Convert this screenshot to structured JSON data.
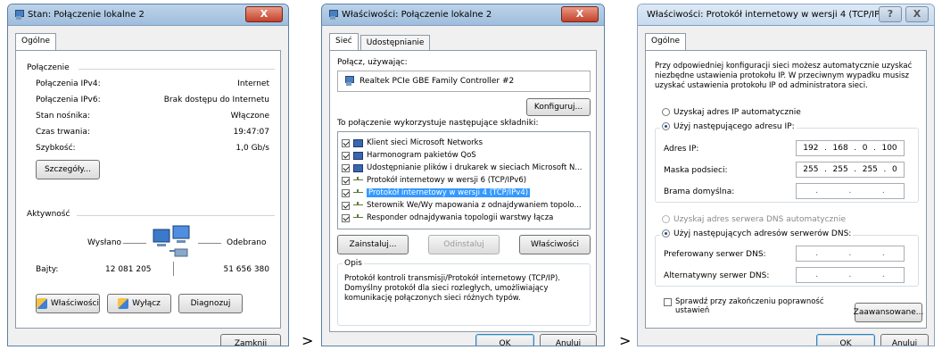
{
  "win1": {
    "title": "Stan: Połączenie lokalne 2",
    "close": "X",
    "tab": "Ogólne",
    "connection_header": "Połączenie",
    "rows": [
      {
        "label": "Połączenia IPv4:",
        "value": "Internet"
      },
      {
        "label": "Połączenia IPv6:",
        "value": "Brak dostępu do Internetu"
      },
      {
        "label": "Stan nośnika:",
        "value": "Włączone"
      },
      {
        "label": "Czas trwania:",
        "value": "19:47:07"
      },
      {
        "label": "Szybkość:",
        "value": "1,0 Gb/s"
      }
    ],
    "details_btn": "Szczegóły...",
    "activity_header": "Aktywność",
    "sent": "Wysłano",
    "received": "Odebrano",
    "bytes_label": "Bajty:",
    "bytes_sent": "12 081 205",
    "bytes_recv": "51 656 380",
    "props_btn": "Właściwości",
    "disable_btn": "Wyłącz",
    "diag_btn": "Diagnozuj",
    "close_btn": "Zamknij"
  },
  "win2": {
    "title": "Właściwości: Połączenie lokalne 2",
    "close": "X",
    "tab_net": "Sieć",
    "tab_share": "Udostępnianie",
    "connect_using": "Połącz, używając:",
    "adapter": "Realtek PCIe GBE Family Controller #2",
    "configure_btn": "Konfiguruj...",
    "uses_label": "To połączenie wykorzystuje następujące składniki:",
    "components": [
      {
        "label": "Klient sieci Microsoft Networks",
        "checked": true,
        "icon": "network"
      },
      {
        "label": "Harmonogram pakietów QoS",
        "checked": true,
        "icon": "network"
      },
      {
        "label": "Udostępnianie plików i drukarek w sieciach Microsoft N...",
        "checked": true,
        "icon": "network"
      },
      {
        "label": "Protokół internetowy w wersji 6 (TCP/IPv6)",
        "checked": true,
        "icon": "protocol"
      },
      {
        "label": "Protokół internetowy w wersji 4 (TCP/IPv4)",
        "checked": true,
        "icon": "protocol"
      },
      {
        "label": "Sterownik We/Wy mapowania z odnajdywaniem topolo...",
        "checked": true,
        "icon": "protocol"
      },
      {
        "label": "Responder odnajdywania topologii warstwy łącza",
        "checked": true,
        "icon": "protocol"
      }
    ],
    "install_btn": "Zainstaluj...",
    "uninstall_btn": "Odinstaluj",
    "props_btn": "Właściwości",
    "desc_header": "Opis",
    "desc_text": "Protokół kontroli transmisji/Protokół internetowy (TCP/IP). Domyślny protokół dla sieci rozległych, umożliwiający komunikację połączonych sieci różnych typów.",
    "ok_btn": "OK",
    "cancel_btn": "Anuluj"
  },
  "win3": {
    "title": "Właściwości: Protokół internetowy w wersji 4 (TCP/IPv4)",
    "help": "?",
    "close": "X",
    "tab": "Ogólne",
    "intro": "Przy odpowiedniej konfiguracji sieci możesz automatycznie uzyskać niezbędne ustawienia protokołu IP. W przeciwnym wypadku musisz uzyskać ustawienia protokołu IP od administratora sieci.",
    "auto_ip": "Uzyskaj adres IP automatycznie",
    "use_ip": "Użyj następującego adresu IP:",
    "ip_label": "Adres IP:",
    "ip": [
      "192",
      "168",
      "0",
      "100"
    ],
    "mask_label": "Maska podsieci:",
    "mask": [
      "255",
      "255",
      "255",
      "0"
    ],
    "gw_label": "Brama domyślna:",
    "auto_dns": "Uzyskaj adres serwera DNS automatycznie",
    "use_dns": "Użyj następujących adresów serwerów DNS:",
    "pref_dns_label": "Preferowany serwer DNS:",
    "alt_dns_label": "Alternatywny serwer DNS:",
    "validate_label": "Sprawdź przy zakończeniu poprawność ustawień",
    "advanced_btn": "Zaawansowane...",
    "ok_btn": "OK",
    "cancel_btn": "Anuluj"
  },
  "arrows": [
    ">",
    ">"
  ]
}
